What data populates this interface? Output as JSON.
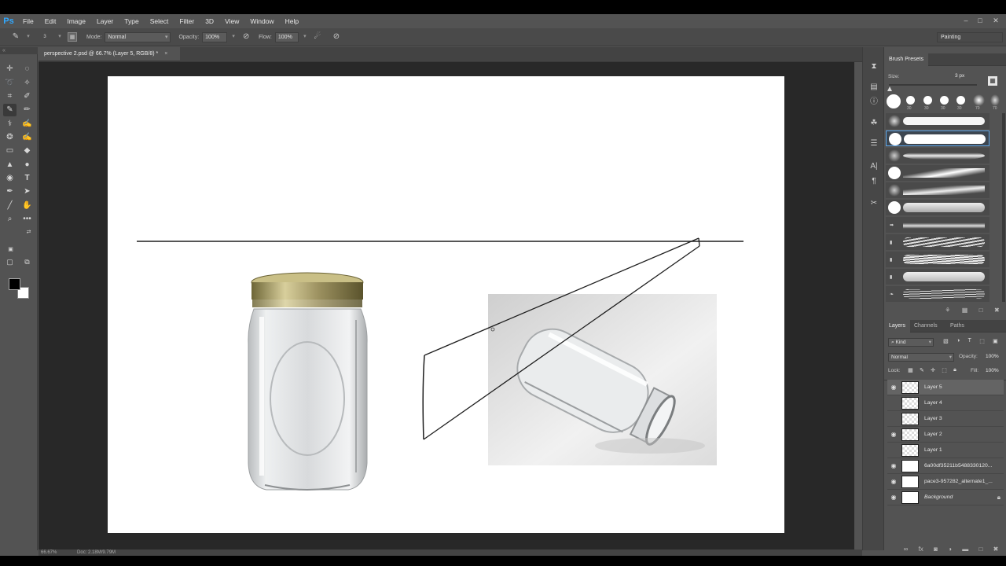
{
  "app": {
    "logo": "Ps"
  },
  "menu": [
    "File",
    "Edit",
    "Image",
    "Layer",
    "Type",
    "Select",
    "Filter",
    "3D",
    "View",
    "Window",
    "Help"
  ],
  "window_controls": [
    "–",
    "□",
    "✕"
  ],
  "options": {
    "mode_label": "Mode:",
    "mode_value": "Normal",
    "opacity_label": "Opacity:",
    "opacity_value": "100%",
    "flow_label": "Flow:",
    "flow_value": "100%",
    "brush_size_hint": "3"
  },
  "workspace": "Painting",
  "document": {
    "tab_title": "perspective 2.psd @ 66.7% (Layer 5, RGB/8) *",
    "close": "×"
  },
  "status": {
    "zoom": "66.67%",
    "doc": "Doc: 2.18M/9.79M"
  },
  "brush_presets": {
    "tab": "Brush Presets",
    "size_label": "Size:",
    "size_value": "3 px",
    "tip_sizes": [
      "30",
      "30",
      "30",
      "30",
      "70",
      "70"
    ]
  },
  "layers_panel": {
    "tabs": [
      "Layers",
      "Channels",
      "Paths"
    ],
    "filter_kind": "Kind",
    "blend_mode": "Normal",
    "opacity_label": "Opacity:",
    "opacity_value": "100%",
    "lock_label": "Lock:",
    "fill_label": "Fill:",
    "fill_value": "100%",
    "layers": [
      {
        "name": "Layer 5",
        "visible": true,
        "selected": true
      },
      {
        "name": "Layer 4",
        "visible": false
      },
      {
        "name": "Layer 3",
        "visible": false
      },
      {
        "name": "Layer 2",
        "visible": true
      },
      {
        "name": "Layer 1",
        "visible": false
      },
      {
        "name": "6a00df35211b5488330120...",
        "visible": true
      },
      {
        "name": "pace3-957282_alternate1_...",
        "visible": true
      },
      {
        "name": "Background",
        "visible": true,
        "locked": true
      }
    ]
  },
  "colors": {
    "accent": "#31a8ff",
    "foreground": "#000000",
    "background": "#ffffff"
  }
}
